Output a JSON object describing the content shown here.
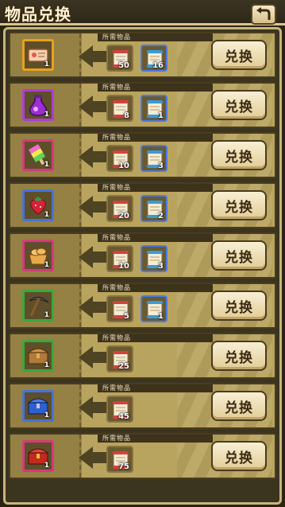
{
  "header": {
    "title": "物品兑换"
  },
  "colors": {
    "orange": "#e8a21a",
    "purple": "#b13bd6",
    "green": "#3aa83a",
    "blue": "#4673d6",
    "pink": "#d43a7a",
    "red": "#b2251c"
  },
  "rows": [
    {
      "item": {
        "icon": "ticket-icon",
        "rarity": "orange",
        "count": "1"
      },
      "need_label": "所需物品",
      "reqs": [
        {
          "icon": "red-scroll-icon",
          "count": "50"
        },
        {
          "icon": "blue-scroll-icon",
          "count": "16"
        }
      ],
      "button": "兑换"
    },
    {
      "item": {
        "icon": "purple-potion-icon",
        "rarity": "purple",
        "count": "1"
      },
      "need_label": "所需物品",
      "reqs": [
        {
          "icon": "red-scroll-icon",
          "count": "8"
        },
        {
          "icon": "blue-scroll-icon",
          "count": "1"
        }
      ],
      "button": "兑换"
    },
    {
      "item": {
        "icon": "popsicle-icon",
        "rarity": "pink",
        "count": "1"
      },
      "need_label": "所需物品",
      "reqs": [
        {
          "icon": "red-scroll-icon",
          "count": "10"
        },
        {
          "icon": "blue-scroll-icon",
          "count": "3"
        }
      ],
      "button": "兑换"
    },
    {
      "item": {
        "icon": "strawberry-icon",
        "rarity": "blue",
        "count": "1"
      },
      "need_label": "所需物品",
      "reqs": [
        {
          "icon": "red-scroll-icon",
          "count": "20"
        },
        {
          "icon": "blue-scroll-icon",
          "count": "2"
        }
      ],
      "button": "兑换"
    },
    {
      "item": {
        "icon": "bread-basket-icon",
        "rarity": "pink",
        "count": "1"
      },
      "need_label": "所需物品",
      "reqs": [
        {
          "icon": "red-scroll-icon",
          "count": "10"
        },
        {
          "icon": "blue-scroll-icon",
          "count": "3"
        }
      ],
      "button": "兑换"
    },
    {
      "item": {
        "icon": "pickaxe-icon",
        "rarity": "green",
        "count": "1"
      },
      "need_label": "所需物品",
      "reqs": [
        {
          "icon": "red-scroll-icon",
          "count": "5"
        },
        {
          "icon": "blue-scroll-icon",
          "count": "1"
        }
      ],
      "button": "兑换"
    },
    {
      "item": {
        "icon": "wooden-chest-icon",
        "rarity": "green",
        "count": "1"
      },
      "need_label": "所需物品",
      "reqs": [
        {
          "icon": "red-scroll-icon",
          "count": "25"
        }
      ],
      "button": "兑换"
    },
    {
      "item": {
        "icon": "blue-chest-icon",
        "rarity": "blue",
        "count": "1"
      },
      "need_label": "所需物品",
      "reqs": [
        {
          "icon": "red-scroll-icon",
          "count": "45"
        }
      ],
      "button": "兑换"
    },
    {
      "item": {
        "icon": "red-chest-icon",
        "rarity": "pink",
        "count": "1"
      },
      "need_label": "所需物品",
      "reqs": [
        {
          "icon": "red-scroll-icon",
          "count": "75"
        }
      ],
      "button": "兑换"
    }
  ]
}
